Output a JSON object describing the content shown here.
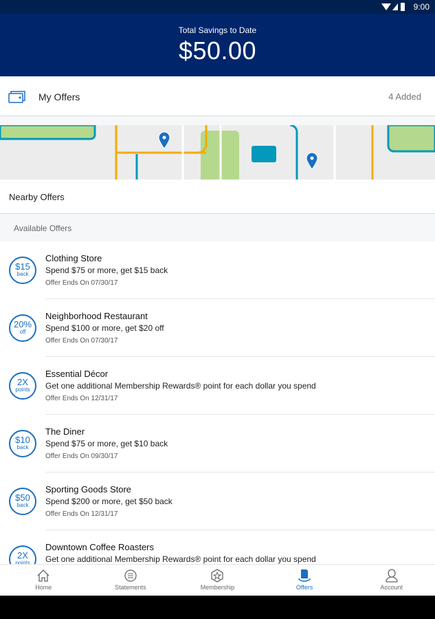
{
  "status_bar": {
    "time": "9:00",
    "icons": [
      "wifi-icon",
      "signal-icon",
      "battery-icon"
    ]
  },
  "header": {
    "label": "Total Savings to Date",
    "amount": "$50.00"
  },
  "my_offers": {
    "title": "My Offers",
    "count": "4 Added",
    "icon": "cards-icon"
  },
  "nearby": {
    "title": "Nearby Offers"
  },
  "available": {
    "title": "Available Offers"
  },
  "offers": [
    {
      "badge_value": "$15",
      "badge_unit": "back",
      "name": "Clothing Store",
      "desc": "Spend $75 or more, get $15 back",
      "ends": "Offer Ends On 07/30/17"
    },
    {
      "badge_value": "20%",
      "badge_unit": "off",
      "name": "Neighborhood Restaurant",
      "desc": "Spend $100 or more, get $20 off",
      "ends": "Offer Ends On 07/30/17"
    },
    {
      "badge_value": "2X",
      "badge_unit": "points",
      "name": "Essential Décor",
      "desc": "Get one additional Membership Rewards® point for each dollar you spend",
      "ends": "Offer Ends On 12/31/17"
    },
    {
      "badge_value": "$10",
      "badge_unit": "back",
      "name": "The Diner",
      "desc": "Spend $75 or more, get $10 back",
      "ends": "Offer Ends On 09/30/17"
    },
    {
      "badge_value": "$50",
      "badge_unit": "back",
      "name": "Sporting Goods Store",
      "desc": "Spend $200 or more, get $50 back",
      "ends": "Offer Ends On 12/31/17"
    },
    {
      "badge_value": "2X",
      "badge_unit": "points",
      "name": "Downtown Coffee Roasters",
      "desc": "Get one additional Membership Rewards® point for each dollar you spend",
      "ends": ""
    }
  ],
  "nav": [
    {
      "label": "Home",
      "icon": "home-icon"
    },
    {
      "label": "Statements",
      "icon": "statements-icon"
    },
    {
      "label": "Membership",
      "icon": "membership-icon"
    },
    {
      "label": "Offers",
      "icon": "offers-icon",
      "active": true
    },
    {
      "label": "Account",
      "icon": "account-icon"
    }
  ],
  "colors": {
    "header": "#00256b",
    "accent": "#1a6fc4"
  }
}
